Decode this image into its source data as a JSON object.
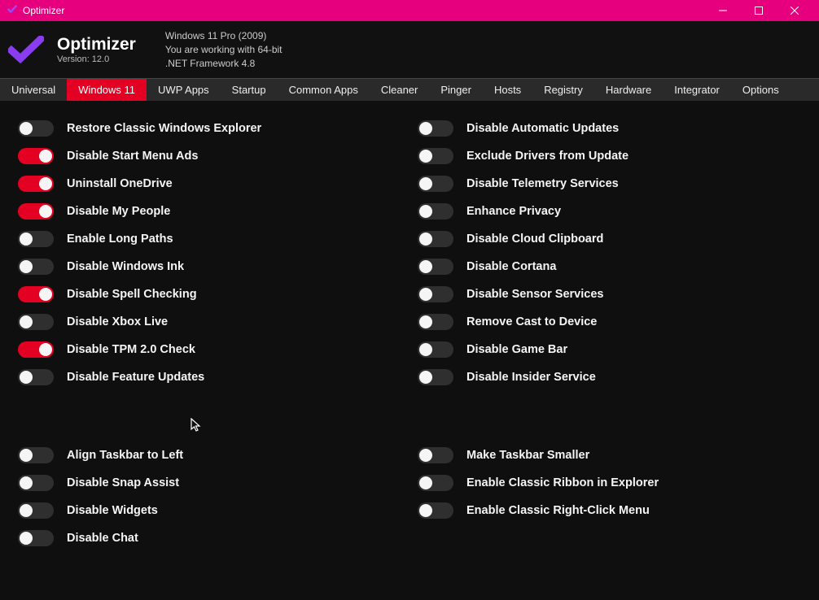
{
  "window": {
    "title": "Optimizer"
  },
  "header": {
    "app_title": "Optimizer",
    "version": "Version: 12.0",
    "env_line1": "Windows 11 Pro (2009)",
    "env_line2": "You are working with 64-bit",
    "env_line3": ".NET Framework 4.8"
  },
  "tabs": [
    {
      "id": "universal",
      "label": "Universal",
      "active": false
    },
    {
      "id": "windows11",
      "label": "Windows 11",
      "active": true
    },
    {
      "id": "uwp",
      "label": "UWP Apps",
      "active": false
    },
    {
      "id": "startup",
      "label": "Startup",
      "active": false
    },
    {
      "id": "commonapps",
      "label": "Common Apps",
      "active": false
    },
    {
      "id": "cleaner",
      "label": "Cleaner",
      "active": false
    },
    {
      "id": "pinger",
      "label": "Pinger",
      "active": false
    },
    {
      "id": "hosts",
      "label": "Hosts",
      "active": false
    },
    {
      "id": "registry",
      "label": "Registry",
      "active": false
    },
    {
      "id": "hardware",
      "label": "Hardware",
      "active": false
    },
    {
      "id": "integrator",
      "label": "Integrator",
      "active": false
    },
    {
      "id": "options",
      "label": "Options",
      "active": false
    }
  ],
  "toggles_left_a": [
    {
      "key": "restore_explorer",
      "label": "Restore Classic Windows Explorer",
      "on": false
    },
    {
      "key": "disable_start_ads",
      "label": "Disable Start Menu Ads",
      "on": true
    },
    {
      "key": "uninstall_onedrive",
      "label": "Uninstall OneDrive",
      "on": true
    },
    {
      "key": "disable_my_people",
      "label": "Disable My People",
      "on": true
    },
    {
      "key": "enable_long_paths",
      "label": "Enable Long Paths",
      "on": false
    },
    {
      "key": "disable_ink",
      "label": "Disable Windows Ink",
      "on": false
    },
    {
      "key": "disable_spell",
      "label": "Disable Spell Checking",
      "on": true
    },
    {
      "key": "disable_xbox",
      "label": "Disable Xbox Live",
      "on": false
    },
    {
      "key": "disable_tpm",
      "label": "Disable TPM 2.0 Check",
      "on": true
    },
    {
      "key": "disable_feature",
      "label": "Disable Feature Updates",
      "on": false
    }
  ],
  "toggles_right_a": [
    {
      "key": "disable_auto_upd",
      "label": "Disable Automatic Updates",
      "on": false
    },
    {
      "key": "exclude_drivers",
      "label": "Exclude Drivers from Update",
      "on": false
    },
    {
      "key": "disable_telemetry",
      "label": "Disable Telemetry Services",
      "on": false
    },
    {
      "key": "enhance_privacy",
      "label": "Enhance Privacy",
      "on": false
    },
    {
      "key": "disable_cloudclip",
      "label": "Disable Cloud Clipboard",
      "on": false
    },
    {
      "key": "disable_cortana",
      "label": "Disable Cortana",
      "on": false
    },
    {
      "key": "disable_sensor",
      "label": "Disable Sensor Services",
      "on": false
    },
    {
      "key": "remove_cast",
      "label": "Remove Cast to Device",
      "on": false
    },
    {
      "key": "disable_gamebar",
      "label": "Disable Game Bar",
      "on": false
    },
    {
      "key": "disable_insider",
      "label": "Disable Insider Service",
      "on": false
    }
  ],
  "toggles_left_b": [
    {
      "key": "align_taskbar_left",
      "label": "Align Taskbar to Left",
      "on": false
    },
    {
      "key": "disable_snap",
      "label": "Disable Snap Assist",
      "on": false
    },
    {
      "key": "disable_widgets",
      "label": "Disable Widgets",
      "on": false
    },
    {
      "key": "disable_chat",
      "label": "Disable Chat",
      "on": false
    }
  ],
  "toggles_right_b": [
    {
      "key": "taskbar_smaller",
      "label": "Make Taskbar Smaller",
      "on": false
    },
    {
      "key": "classic_ribbon",
      "label": "Enable Classic Ribbon in Explorer",
      "on": false
    },
    {
      "key": "classic_rclick",
      "label": "Enable Classic Right-Click Menu",
      "on": false
    }
  ]
}
